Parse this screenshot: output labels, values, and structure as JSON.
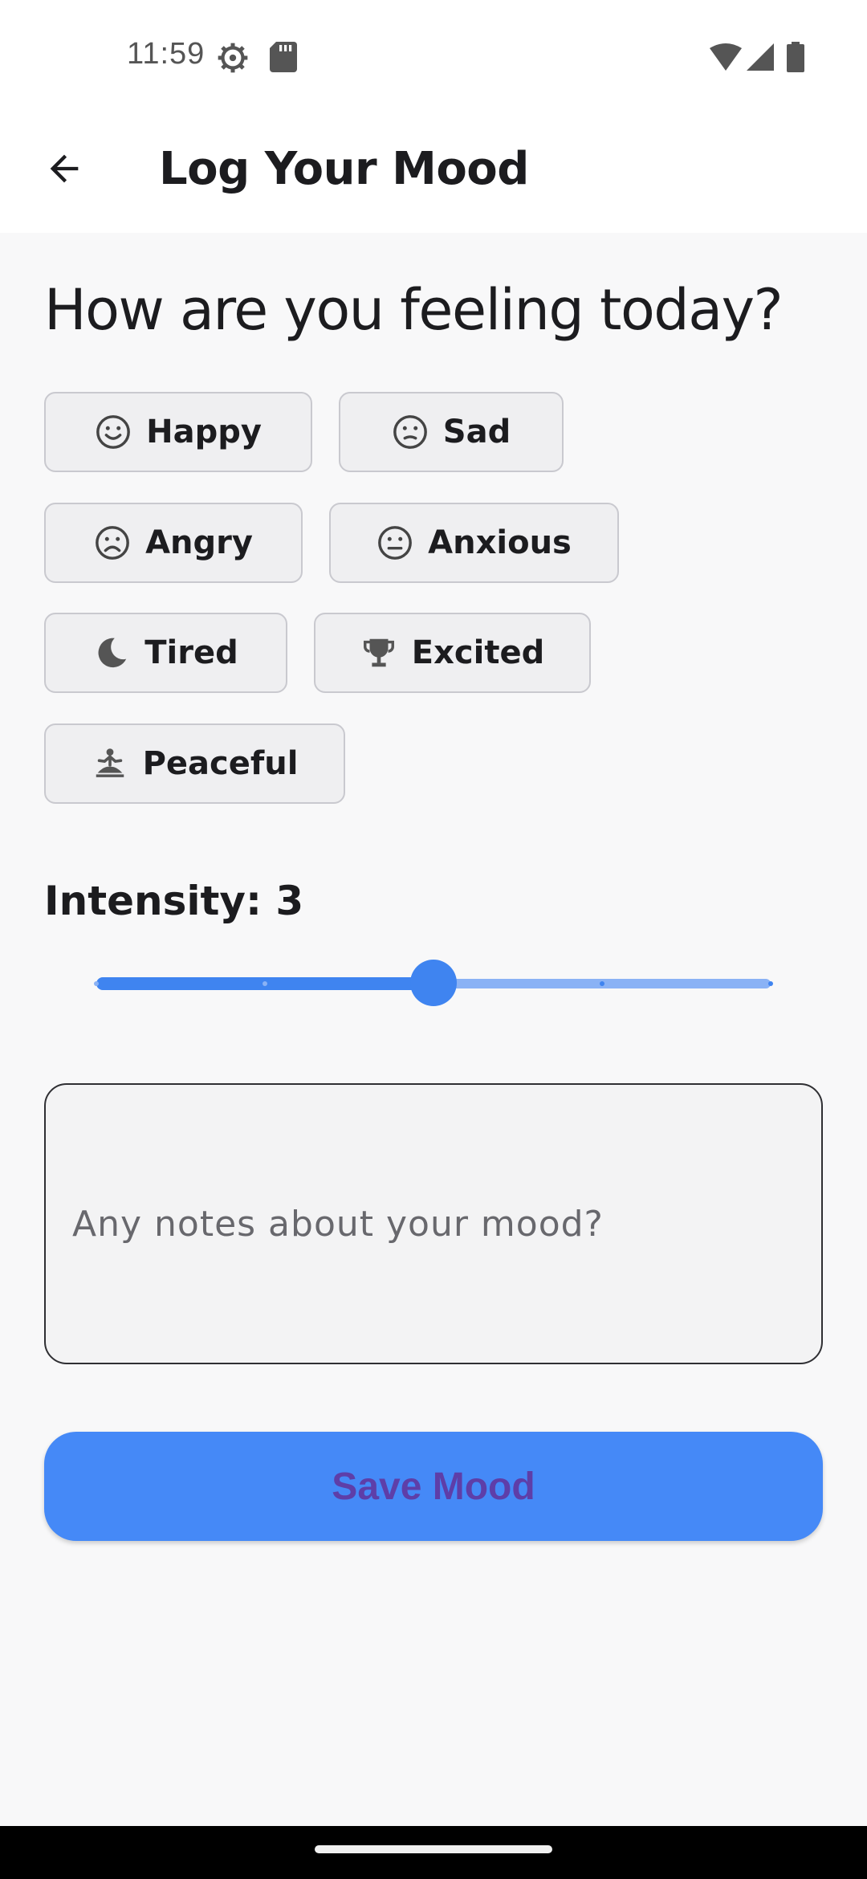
{
  "status_bar": {
    "time": "11:59",
    "icons": [
      "settings-icon",
      "sd-card-icon",
      "wifi-icon",
      "signal-icon",
      "battery-icon"
    ]
  },
  "app_bar": {
    "title": "Log Your Mood",
    "back_icon": "arrow-back-icon"
  },
  "headline": "How are you feeling today?",
  "moods": [
    {
      "label": "Happy",
      "icon": "smile-icon"
    },
    {
      "label": "Sad",
      "icon": "sad-face-icon"
    },
    {
      "label": "Angry",
      "icon": "frown-icon"
    },
    {
      "label": "Anxious",
      "icon": "anxious-face-icon"
    },
    {
      "label": "Tired",
      "icon": "moon-icon"
    },
    {
      "label": "Excited",
      "icon": "trophy-icon"
    },
    {
      "label": "Peaceful",
      "icon": "meditation-icon"
    }
  ],
  "intensity": {
    "label": "Intensity: 3",
    "value": 3,
    "min": 1,
    "max": 5
  },
  "notes": {
    "placeholder": "Any notes about your mood?",
    "value": ""
  },
  "save_button": {
    "label": "Save Mood"
  },
  "colors": {
    "accent": "#3f84f0",
    "button_bg": "#4589f7",
    "button_text": "#5e3ea8",
    "chip_bg": "#efeff1",
    "chip_border": "#c9c9cf"
  }
}
